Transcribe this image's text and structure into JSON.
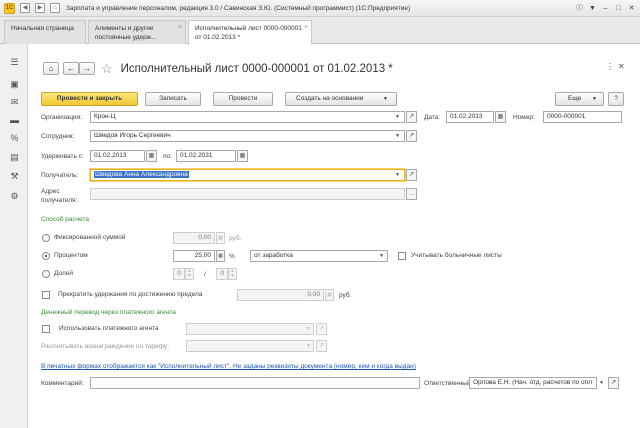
{
  "window": {
    "title": "Зарплата и управление персоналом, редакция 3.0 / Савинская З.Ю. (Системный программист) (1С:Предприятие)",
    "logo": "1С"
  },
  "tabs": [
    {
      "label": "Начальная страница"
    },
    {
      "label": "Алименты и другие постоянные удерж..."
    },
    {
      "label": "Исполнительный лист 0000-000001 от 01.02.2013 *"
    }
  ],
  "sidebar": [
    "menu-icon",
    "desktop-icon",
    "mail-icon",
    "card-icon",
    "percent-icon",
    "report-icon",
    "wrench-icon",
    "gear-icon"
  ],
  "document": {
    "title": "Исполнительный лист 0000-000001 от 01.02.2013 *"
  },
  "toolbar": {
    "post_close": "Провести и закрыть",
    "save": "Записать",
    "post": "Провести",
    "create_based": "Создать на основании",
    "more": "Еще",
    "help": "?"
  },
  "form": {
    "org_label": "Организация:",
    "org_value": "Крон-Ц",
    "date_label": "Дата:",
    "date_value": "01.02.2013",
    "number_label": "Номер:",
    "number_value": "0000-000001",
    "employee_label": "Сотрудник:",
    "employee_value": "Шведов Игорь Сергеевич",
    "hold_from_label": "Удерживать с:",
    "hold_from_value": "01.02.2013",
    "hold_to_label": "по:",
    "hold_to_value": "01.02.2031",
    "recipient_label": "Получатель:",
    "recipient_value": "Шведова Анна Александровна",
    "address_label": "Адрес получателя:",
    "address_value": "",
    "calc_method_header": "Способ расчета",
    "fixed_label": "Фиксированной суммой",
    "fixed_value": "0,00",
    "fixed_unit": "руб.",
    "percent_label": "Процентом",
    "percent_value": "25,00",
    "percent_unit": "%",
    "percent_base": "от заработка",
    "sick_label": "Учитывать больничные листы",
    "share_label": "Долей",
    "share_num": "0",
    "share_sep": "/",
    "share_den": "0",
    "stop_label": "Прекратить удержания по достижению предела",
    "stop_value": "0,00",
    "stop_unit": "руб.",
    "transfer_header": "Денежный перевод через платежного агента",
    "agent_label": "Использовать платежного агента",
    "fee_label": "Рассчитывать вознаграждение по тарифу:",
    "print_link": "В печатных формах отображается как \"Исполнительный лист\". Не заданы реквизиты документа (номер, кем и когда выдан)",
    "comment_label": "Комментарий:",
    "comment_value": "",
    "responsible_label": "Ответственный:",
    "responsible_value": "Орлова Е.Н. (Нач. отд. расчетов по опл"
  }
}
